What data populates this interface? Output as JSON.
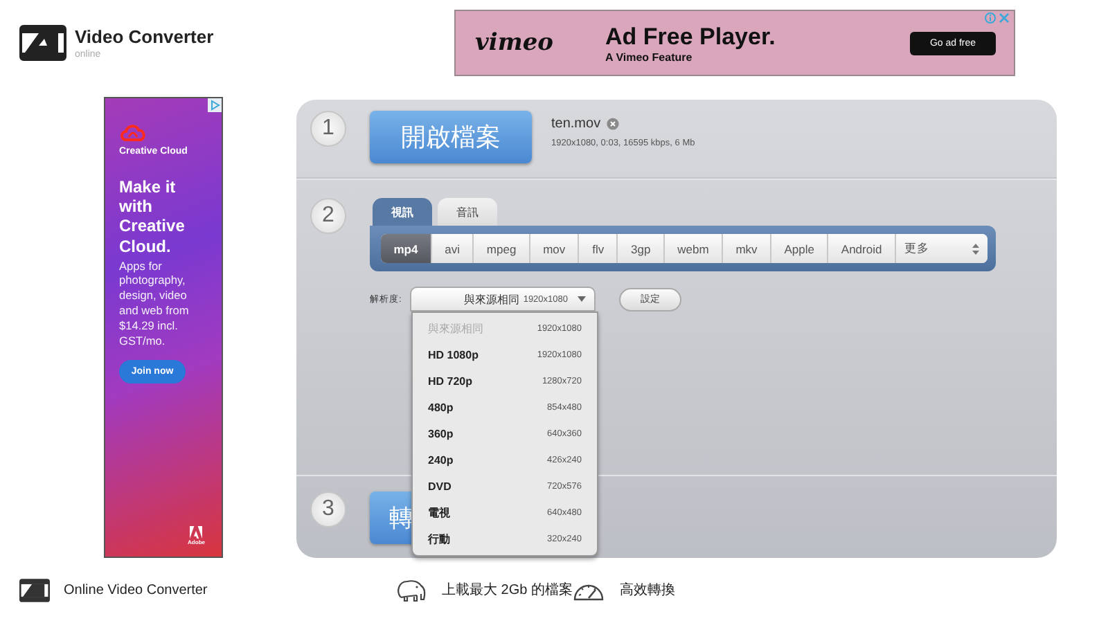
{
  "header": {
    "title": "Video Converter",
    "subtitle": "online"
  },
  "banner_ad": {
    "logo": "vimeo",
    "headline": "Ad Free Player.",
    "tagline": "A Vimeo Feature",
    "button": "Go ad free"
  },
  "side_ad": {
    "brand": "Creative Cloud",
    "headline": "Make it with Creative Cloud.",
    "body": "Apps for photography, design, video and web from $14.29 incl. GST/mo.",
    "button": "Join now",
    "maker": "Adobe"
  },
  "open_step": {
    "number": "1",
    "button": "開啟檔案",
    "file_name": "ten.mov",
    "file_info": "1920x1080, 0:03, 16595 kbps, 6 Mb"
  },
  "format_step": {
    "number": "2",
    "tabs": [
      {
        "label": "視訊",
        "selected": true
      },
      {
        "label": "音訊",
        "selected": false
      }
    ],
    "formats": [
      {
        "label": "mp4",
        "selected": true
      },
      {
        "label": "avi",
        "selected": false
      },
      {
        "label": "mpeg",
        "selected": false
      },
      {
        "label": "mov",
        "selected": false
      },
      {
        "label": "flv",
        "selected": false
      },
      {
        "label": "3gp",
        "selected": false
      },
      {
        "label": "webm",
        "selected": false
      },
      {
        "label": "mkv",
        "selected": false
      },
      {
        "label": "Apple",
        "selected": false
      },
      {
        "label": "Android",
        "selected": false
      }
    ],
    "more": "更多",
    "resolution": {
      "label": "解析度:",
      "value": "與來源相同",
      "value_size": "1920x1080",
      "expanded": true,
      "options": [
        {
          "name": "與來源相同",
          "size": "1920x1080",
          "disabled": true
        },
        {
          "name": "HD 1080p",
          "size": "1920x1080",
          "disabled": false
        },
        {
          "name": "HD 720p",
          "size": "1280x720",
          "disabled": false
        },
        {
          "name": "480p",
          "size": "854x480",
          "disabled": false
        },
        {
          "name": "360p",
          "size": "640x360",
          "disabled": false
        },
        {
          "name": "240p",
          "size": "426x240",
          "disabled": false
        },
        {
          "name": "DVD",
          "size": "720x576",
          "disabled": false
        },
        {
          "name": "電視",
          "size": "640x480",
          "disabled": false
        },
        {
          "name": "行動",
          "size": "320x240",
          "disabled": false
        }
      ]
    },
    "settings_button": "設定"
  },
  "convert_step": {
    "number": "3",
    "button": "轉"
  },
  "features": [
    {
      "kind": "film",
      "title": "Online Video Converter"
    },
    {
      "kind": "elephant",
      "title": "上載最大 2Gb 的檔案"
    },
    {
      "kind": "gauge",
      "title": "高效轉換"
    }
  ]
}
